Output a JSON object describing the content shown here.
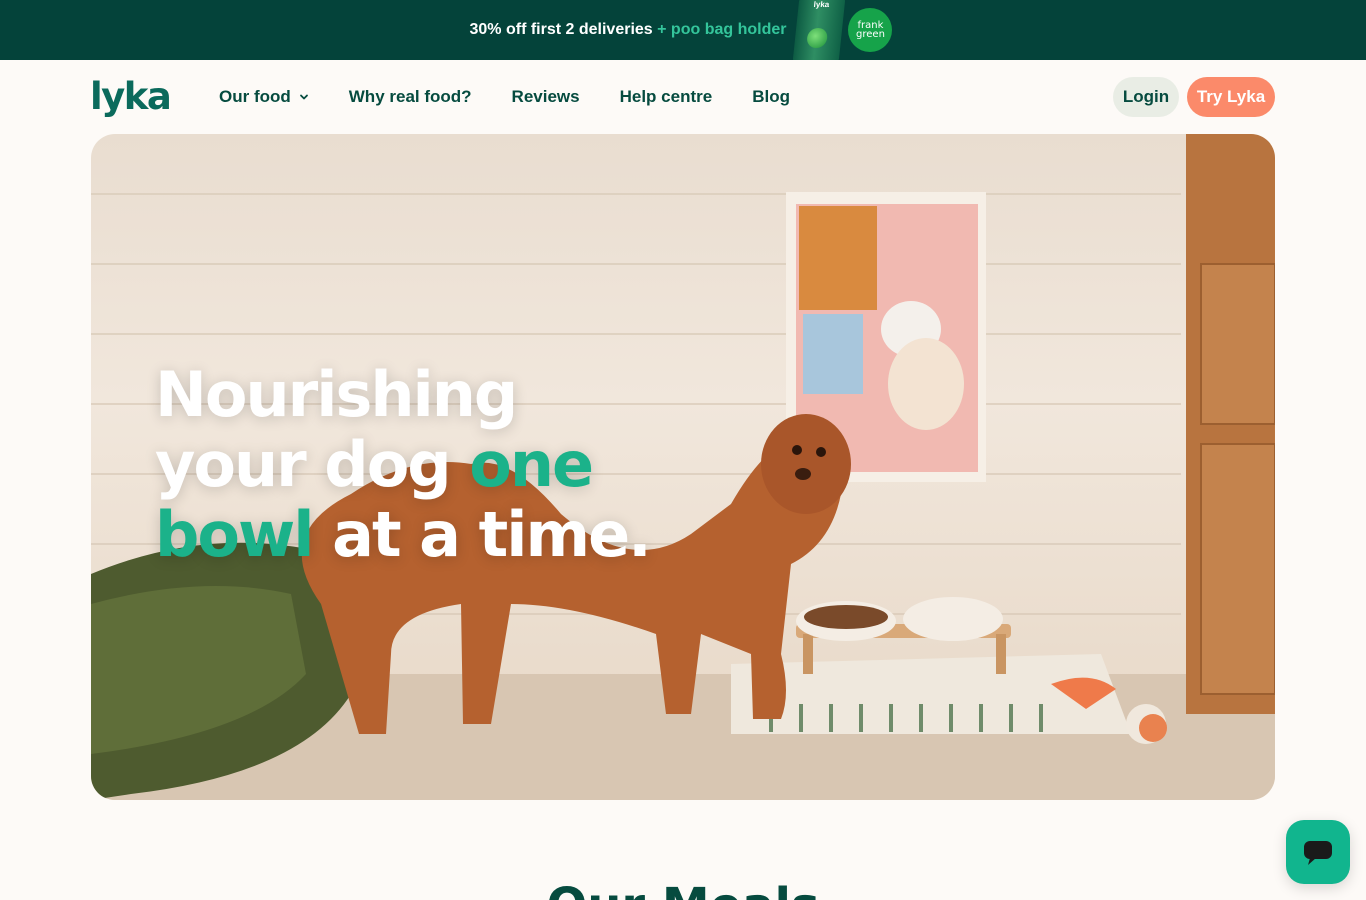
{
  "promo": {
    "text": "30% off first 2 deliveries",
    "accent": "+ poo bag holder",
    "bottle_label": "lyka",
    "partner_line1": "frank",
    "partner_line2": "green"
  },
  "header": {
    "logo": "lyka",
    "nav": [
      {
        "label": "Our food",
        "has_dropdown": true,
        "icon": "chevron-down-icon"
      },
      {
        "label": "Why real food?"
      },
      {
        "label": "Reviews"
      },
      {
        "label": "Help centre"
      },
      {
        "label": "Blog"
      }
    ],
    "login_label": "Login",
    "cta_label": "Try Lyka"
  },
  "hero": {
    "title_part1": "Nourishing your dog",
    "title_highlight": "one bowl",
    "title_part2": "at a time.",
    "image_alt": "curly-haired dog standing beside food bowls"
  },
  "section": {
    "heading": "Our Meals"
  },
  "chat": {
    "icon": "chat-bubble-icon"
  },
  "colors": {
    "promo_bg": "#04433a",
    "promo_accent": "#34c59b",
    "brand_dark": "#064b3f",
    "brand_green": "#1bb28a",
    "cta": "#fb8a6a",
    "login_bg": "#e9ede5",
    "page_bg": "#fdfaf7"
  }
}
